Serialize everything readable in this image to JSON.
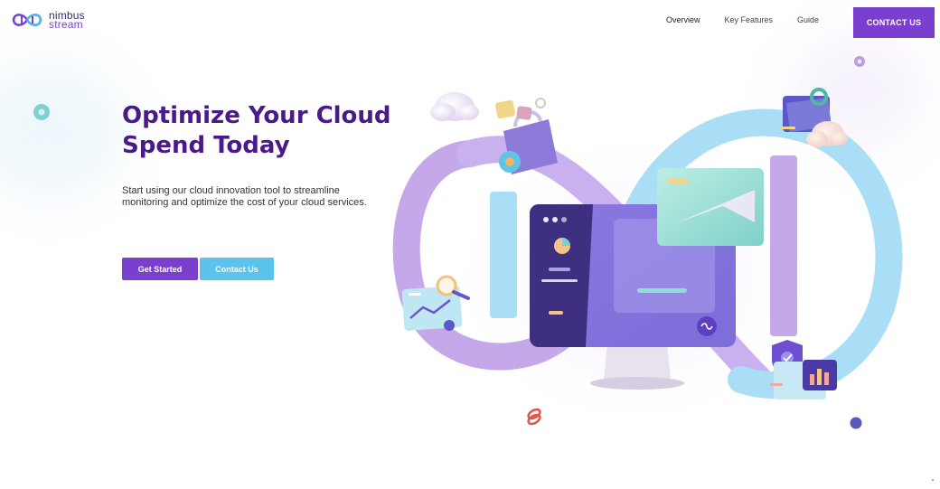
{
  "brand": {
    "name_line1": "nimbus",
    "name_line2": "stream"
  },
  "nav": {
    "items": [
      {
        "label": "Overview"
      },
      {
        "label": "Key Features"
      },
      {
        "label": "Guide"
      }
    ],
    "contact_label": "CONTACT US"
  },
  "hero": {
    "headline_line1": "Optimize Your Cloud",
    "headline_line2": "Spend Today",
    "subtext_line1": "Start using our cloud innovation tool to streamline",
    "subtext_line2": "monitoring and optimize the cost of your cloud services.",
    "primary_button": "Get Started",
    "secondary_button": "Contact Us"
  },
  "colors": {
    "brand_purple": "#7b3fd0",
    "headline_purple": "#4a1a88",
    "accent_blue": "#5bc3ec",
    "infinity_purple": "#c4a8ea",
    "infinity_blue": "#a9def6"
  },
  "icons": {
    "logo": "infinity-logo-icon",
    "monitor": "monitor-illustration",
    "shield": "shield-check-icon",
    "folder": "folder-icon",
    "bag": "shopping-bag-icon",
    "chart": "analytics-chart-icon",
    "search": "magnifier-icon"
  }
}
